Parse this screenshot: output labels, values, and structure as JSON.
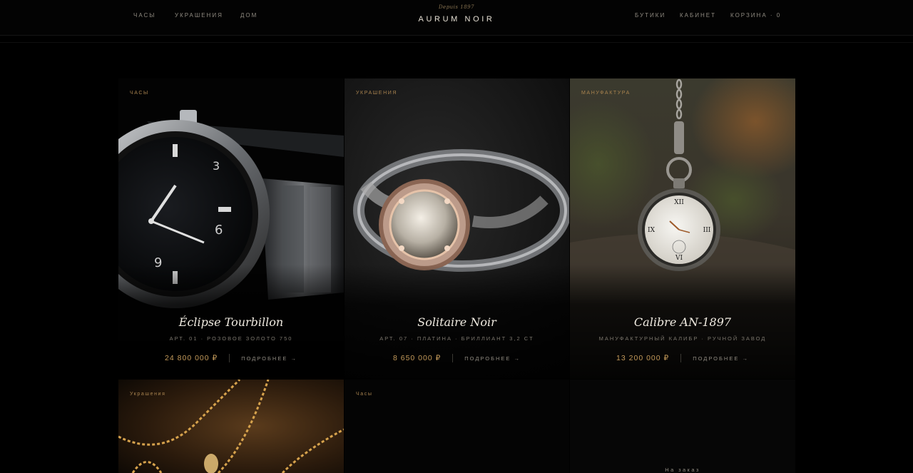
{
  "nav": {
    "left": [
      "Часы",
      "Украшения",
      "Дом"
    ],
    "right": [
      "Бутики",
      "Кабинет",
      "Корзина · 0"
    ]
  },
  "brand": {
    "tagline": "Depuis 1897",
    "name": "AURUM NOIR"
  },
  "cards": [
    {
      "label": "Часы",
      "title": "Éclipse Tourbillon",
      "meta": "Арт. 01 · розовое золото 750",
      "price": "24 800 000 ₽",
      "more": "Подробнее →"
    },
    {
      "label": "Украшения",
      "title": "Solitaire Noir",
      "meta": "Арт. 07 · платина · бриллиант 3,2 ct",
      "price": "8 650 000 ₽",
      "more": "Подробнее →"
    },
    {
      "label": "Мануфактура",
      "title": "Calibre AN-1897",
      "meta": "Мануфактурный калибр · ручной завод",
      "price": "13 200 000 ₽",
      "more": "Подробнее →"
    }
  ],
  "bottom_cards": [
    {
      "label": "Украшения"
    },
    {
      "label": "Часы"
    },
    {
      "label": "На заказ"
    }
  ],
  "colors": {
    "accent_gold": "#c49a5a",
    "label_gold": "#a8834f",
    "background": "#000000"
  }
}
